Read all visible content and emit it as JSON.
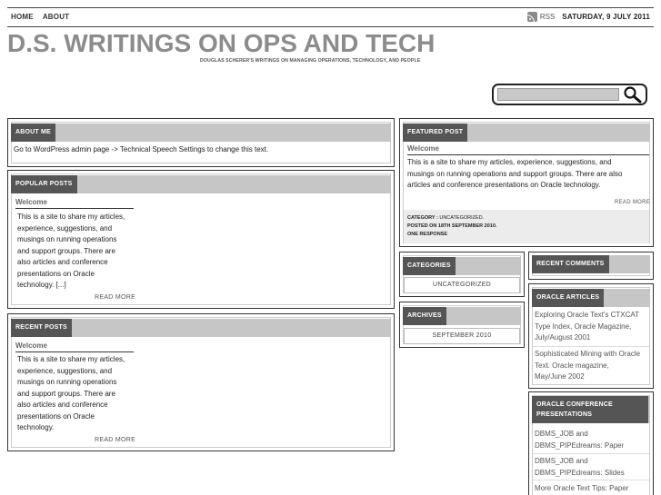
{
  "nav": {
    "home": "HOME",
    "about": "ABOUT"
  },
  "top_right": {
    "rss": "RSS",
    "date": "SATURDAY, 9 JULY 2011"
  },
  "header": {
    "title": "D.S. WRITINGS ON OPS AND TECH",
    "tagline": "DOUGLAS SCHERER'S WRITINGS ON MANAGING OPERATIONS, TECHNOLOGY, AND PEOPLE"
  },
  "search": {
    "value": "",
    "placeholder": ""
  },
  "about": {
    "title": "ABOUT ME",
    "text": "Go to WordPress admin page -> Technical Speech Settings to change this text."
  },
  "popular": {
    "title": "POPULAR POSTS",
    "post_title": "Welcome",
    "lines": [
      "This is a site to share my articles,",
      "experience, suggestions, and",
      "musings on running operations",
      "and support groups. There are",
      "also articles and conference",
      "presentations on Oracle",
      "technology. [...]"
    ],
    "read_more": "READ MORE"
  },
  "recent": {
    "title": "RECENT POSTS",
    "post_title": "Welcome",
    "lines": [
      "This is a site to share my articles,",
      "experience, suggestions, and",
      "musings on running operations",
      "and support groups. There are",
      "also articles and conference",
      "presentations on Oracle",
      "technology."
    ],
    "read_more": "READ MORE"
  },
  "featured": {
    "title": "FEATURED POST",
    "post_title": "Welcome",
    "lines": [
      "This is a site to share my articles, experience, suggestions, and",
      "musings on running operations and support groups. There are also",
      "articles and conference presentations on Oracle technology."
    ],
    "read_more": "READ MORE",
    "category_label": "CATEGORY :",
    "category_value": "UNCATEGORIZED.",
    "posted_on": "POSTED ON 18TH SEPTEMBER 2010.",
    "responses": "ONE RESPONSE"
  },
  "categories": {
    "title": "CATEGORIES",
    "item": "UNCATEGORIZED"
  },
  "archives": {
    "title": "ARCHIVES",
    "item": "SEPTEMBER 2010"
  },
  "recent_comments": {
    "title": "RECENT COMMENTS"
  },
  "oracle_articles": {
    "title": "ORACLE ARTICLES",
    "items": [
      [
        "Exploring Oracle Text's CTXCAT",
        "Type Index, Oracle Magazine,",
        "July/August 2001"
      ],
      [
        "Sophisticated Mining with Oracle",
        "Text. Oracle magazine,",
        "May/June 2002"
      ]
    ]
  },
  "oracle_conf": {
    "title": "ORACLE CONFERENCE PRESENTATIONS",
    "items": [
      [
        "DBMS_JOB and",
        "DBMS_PIPEdreams: Paper"
      ],
      [
        "DBMS_JOB and",
        "DBMS_PIPEdreams: Slides"
      ],
      [
        "More Oracle Text Tips: Paper"
      ]
    ]
  }
}
